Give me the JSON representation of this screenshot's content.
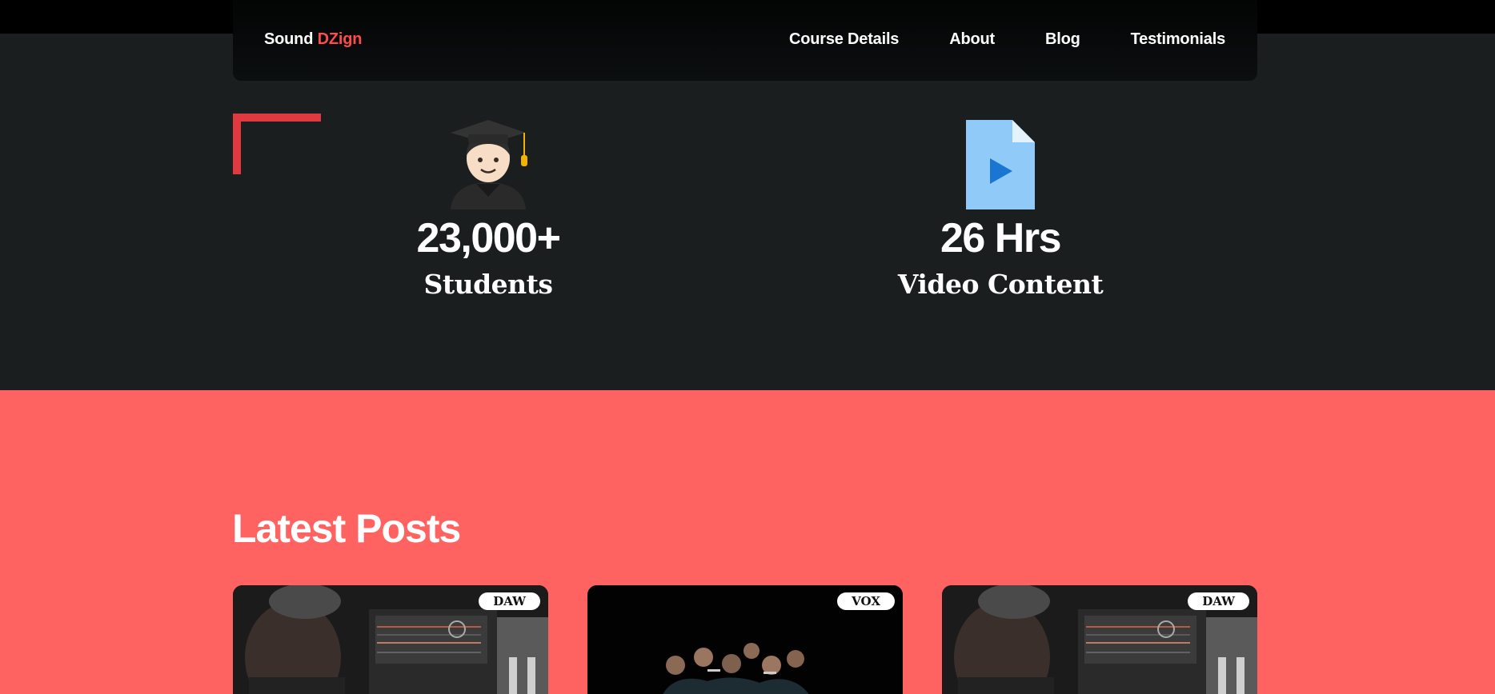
{
  "brand": {
    "name_part1": "Sound",
    "name_part2": "DZign",
    "accent_color": "#ff4b4b"
  },
  "nav": {
    "items": [
      {
        "label": "Course Details"
      },
      {
        "label": "About"
      },
      {
        "label": "Blog"
      },
      {
        "label": "Testimonials"
      }
    ]
  },
  "stats": [
    {
      "icon": "student-graduate-icon",
      "value": "23,000+",
      "label": "Students"
    },
    {
      "icon": "video-file-icon",
      "value": "26 Hrs",
      "label": "Video Content"
    }
  ],
  "posts": {
    "title": "Latest Posts",
    "background_color": "#ff6361",
    "cards": [
      {
        "tag": "DAW",
        "image": "studio-engineer-photo"
      },
      {
        "tag": "VOX",
        "image": "choir-singers-photo"
      },
      {
        "tag": "DAW",
        "image": "studio-engineer-photo"
      }
    ]
  }
}
